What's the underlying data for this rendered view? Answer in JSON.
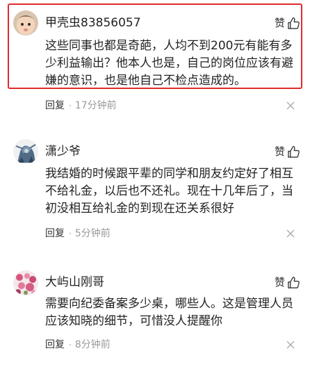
{
  "comments": [
    {
      "username": "甲壳虫83856057",
      "like_label": "赞",
      "text": "这些同事也都是奇葩，人均不到200元有能有多少利益输出？他本人也是，自己的岗位应该有避嫌的意识，也是他自己不检点造成的。",
      "reply_label": "回复",
      "time": "17分钟前",
      "avatar_icon": "baby-avatar"
    },
    {
      "username": "潇少爷",
      "like_label": "赞",
      "text": "我结婚的时候跟平辈的同学和朋友约定好了相互不给礼金，以后也不还礼。现在十几年后了，当初没相互给礼金的到现在还关系很好",
      "reply_label": "回复",
      "time": "5分钟前",
      "avatar_icon": "armored-character-avatar"
    },
    {
      "username": "大屿山刚哥",
      "like_label": "赞",
      "text": "需要向纪委备案多少桌，哪些人。这是管理人员应该知晓的细节，可惜没人提醒你",
      "reply_label": "回复",
      "time": "8分钟前",
      "avatar_icon": "pink-flowers-avatar"
    }
  ],
  "colors": {
    "highlight_border": "#e02a2a",
    "time_text": "#999999",
    "primary_text": "#222222"
  },
  "icons": {
    "like": "thumbs-up-icon",
    "close": "close-icon",
    "separator": "dot"
  }
}
